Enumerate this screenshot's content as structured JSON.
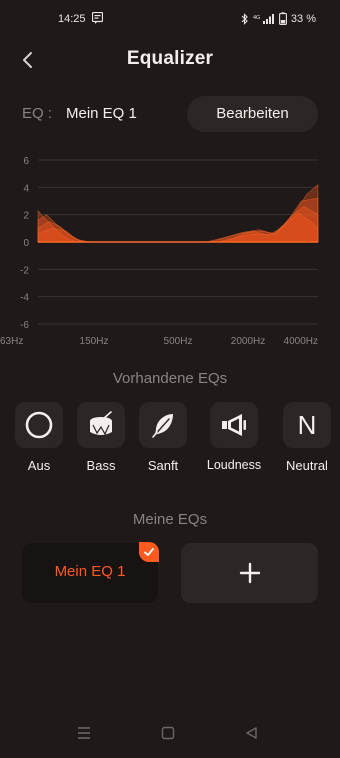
{
  "status_bar": {
    "time": "14:25",
    "battery": "33 %"
  },
  "header": {
    "title": "Equalizer"
  },
  "eq_row": {
    "label": "EQ :",
    "current_name": "Mein EQ 1",
    "edit_label": "Bearbeiten"
  },
  "chart_data": {
    "type": "area",
    "y_ticks": [
      "6",
      "4",
      "2",
      "0",
      "-2",
      "-4",
      "-6"
    ],
    "ylim": [
      -6,
      6
    ],
    "x_ticks": [
      "63Hz",
      "150Hz",
      "500Hz",
      "2000Hz",
      "4000Hz"
    ],
    "x_positions": [
      0,
      0.2,
      0.5,
      0.75,
      1.0
    ],
    "series": [
      {
        "x": [
          0,
          0.02,
          0.05,
          0.08,
          0.11,
          0.14,
          0.17,
          0.22,
          0.6,
          0.66,
          0.72,
          0.77,
          0.82,
          0.87,
          0.92,
          0.96,
          1.0
        ],
        "y": [
          2.3,
          1.8,
          1.2,
          0.6,
          0.2,
          0.0,
          0.0,
          0.0,
          0.0,
          0.3,
          0.6,
          0.8,
          0.5,
          1.0,
          2.2,
          3.5,
          4.2
        ]
      },
      {
        "x": [
          0,
          0.03,
          0.06,
          0.09,
          0.12,
          0.15,
          0.2,
          0.62,
          0.68,
          0.73,
          0.79,
          0.84,
          0.89,
          0.94,
          1.0
        ],
        "y": [
          1.6,
          2.0,
          1.4,
          0.9,
          0.4,
          0.1,
          0.0,
          0.0,
          0.4,
          0.7,
          0.9,
          0.6,
          1.5,
          3.0,
          3.2
        ]
      },
      {
        "x": [
          0,
          0.04,
          0.08,
          0.11,
          0.14,
          0.18,
          0.64,
          0.7,
          0.75,
          0.8,
          0.85,
          0.9,
          0.95,
          1.0
        ],
        "y": [
          1.0,
          1.5,
          1.1,
          0.6,
          0.2,
          0.0,
          0.0,
          0.3,
          0.7,
          0.8,
          0.6,
          1.8,
          2.6,
          2.0
        ]
      },
      {
        "x": [
          0,
          0.05,
          0.1,
          0.13,
          0.16,
          0.66,
          0.72,
          0.78,
          0.84,
          0.88,
          0.93,
          0.98,
          1.0
        ],
        "y": [
          0.6,
          1.0,
          0.8,
          0.3,
          0.0,
          0.0,
          0.4,
          0.6,
          0.5,
          1.2,
          2.1,
          1.4,
          1.0
        ]
      }
    ],
    "colors": {
      "fill": "#ff5a1f",
      "line": "#ff6a2a",
      "grid": "#3a3330",
      "labels": "#8a8380"
    }
  },
  "presets": {
    "title": "Vorhandene EQs",
    "items": [
      {
        "label": "Aus",
        "icon": "circle-icon"
      },
      {
        "label": "Bass",
        "icon": "drum-icon"
      },
      {
        "label": "Sanft",
        "icon": "feather-icon"
      },
      {
        "label": "Loudness",
        "icon": "megaphone-icon"
      },
      {
        "label": "Neutral",
        "icon": "letter-n-icon",
        "glyph": "N"
      }
    ]
  },
  "my_eqs": {
    "title": "Meine EQs",
    "items": [
      {
        "label": "Mein EQ 1",
        "selected": true
      }
    ],
    "add_label": "+"
  },
  "colors": {
    "background": "#1f1a19",
    "accent": "#ff5a1f",
    "surface": "#2c2624"
  }
}
